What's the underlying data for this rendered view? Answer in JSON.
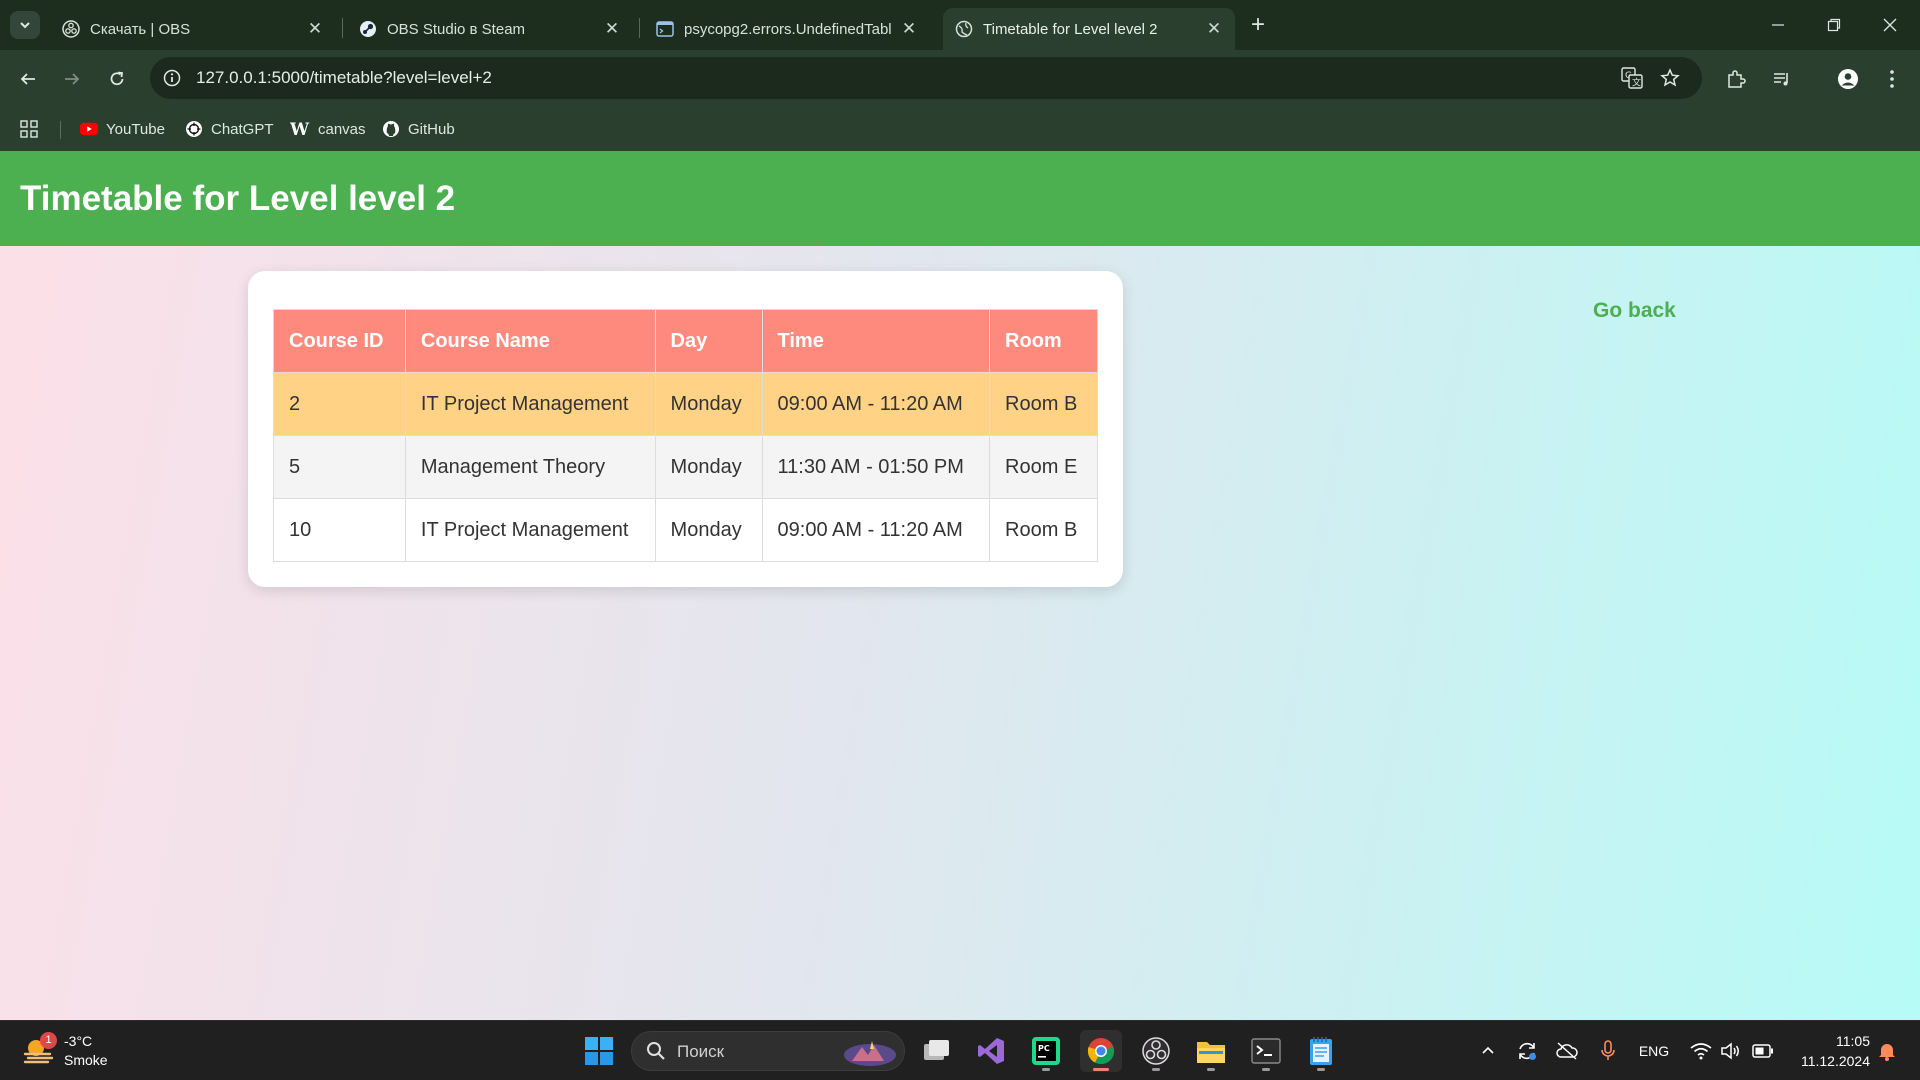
{
  "browser": {
    "tabs": [
      {
        "title": "Скачать | OBS",
        "favicon": "obs-icon"
      },
      {
        "title": "OBS Studio в Steam",
        "favicon": "steam-icon"
      },
      {
        "title": "psycopg2.errors.UndefinedTabl",
        "favicon": "terminal-icon"
      },
      {
        "title": "Timetable for Level level 2",
        "favicon": "globe-icon",
        "active": true
      }
    ],
    "url": "127.0.0.1:5000/timetable?level=level+2",
    "bookmarks": [
      {
        "label": "YouTube",
        "icon": "youtube-icon"
      },
      {
        "label": "ChatGPT",
        "icon": "chatgpt-icon"
      },
      {
        "label": "canvas",
        "icon": "wikipedia-icon"
      },
      {
        "label": "GitHub",
        "icon": "github-icon"
      }
    ]
  },
  "page": {
    "title": "Timetable for Level level 2",
    "go_back": "Go back",
    "table": {
      "headers": [
        "Course ID",
        "Course Name",
        "Day",
        "Time",
        "Room"
      ],
      "rows": [
        [
          "2",
          "IT Project Management",
          "Monday",
          "09:00 AM - 11:20 AM",
          "Room B"
        ],
        [
          "5",
          "Management Theory",
          "Monday",
          "11:30 AM - 01:50 PM",
          "Room E"
        ],
        [
          "10",
          "IT Project Management",
          "Monday",
          "09:00 AM - 11:20 AM",
          "Room B"
        ]
      ]
    }
  },
  "taskbar": {
    "weather": {
      "temp": "-3°C",
      "condition": "Smoke",
      "badge": "1"
    },
    "search_placeholder": "Поиск",
    "language": "ENG",
    "time": "11:05",
    "date": "11.12.2024"
  },
  "colors": {
    "header": "#4caf50",
    "table_header": "#fe8a7e",
    "highlight_row": "#ffd285",
    "link": "#4caf50"
  }
}
